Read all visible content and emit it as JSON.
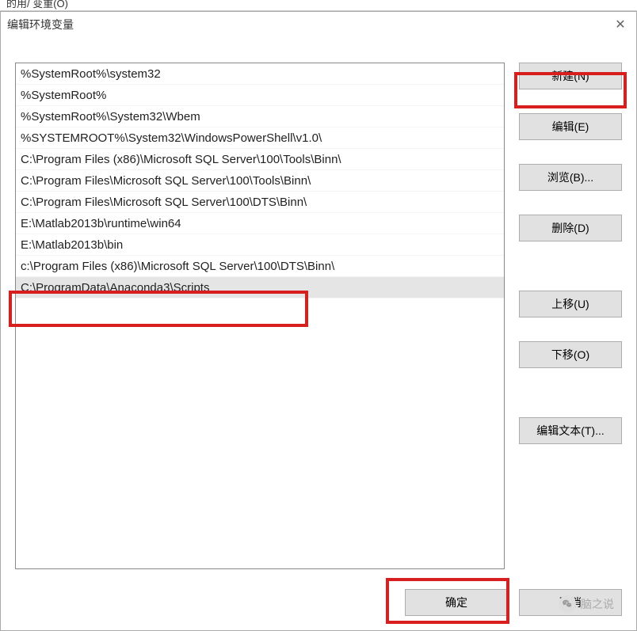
{
  "top_fragment": "的用/ 变重(O)",
  "dialog": {
    "title": "编辑环境变量"
  },
  "paths": [
    "%SystemRoot%\\system32",
    "%SystemRoot%",
    "%SystemRoot%\\System32\\Wbem",
    "%SYSTEMROOT%\\System32\\WindowsPowerShell\\v1.0\\",
    "C:\\Program Files (x86)\\Microsoft SQL Server\\100\\Tools\\Binn\\",
    "C:\\Program Files\\Microsoft SQL Server\\100\\Tools\\Binn\\",
    "C:\\Program Files\\Microsoft SQL Server\\100\\DTS\\Binn\\",
    "E:\\Matlab2013b\\runtime\\win64",
    "E:\\Matlab2013b\\bin",
    "c:\\Program Files (x86)\\Microsoft SQL Server\\100\\DTS\\Binn\\",
    "C:\\ProgramData\\Anaconda3\\Scripts"
  ],
  "selected_index": 10,
  "buttons": {
    "new": "新建(N)",
    "edit": "编辑(E)",
    "browse": "浏览(B)...",
    "delete": "删除(D)",
    "move_up": "上移(U)",
    "move_down": "下移(O)",
    "edit_text": "编辑文本(T)...",
    "ok": "确定",
    "cancel": "取消"
  },
  "watermark": "脑之说"
}
